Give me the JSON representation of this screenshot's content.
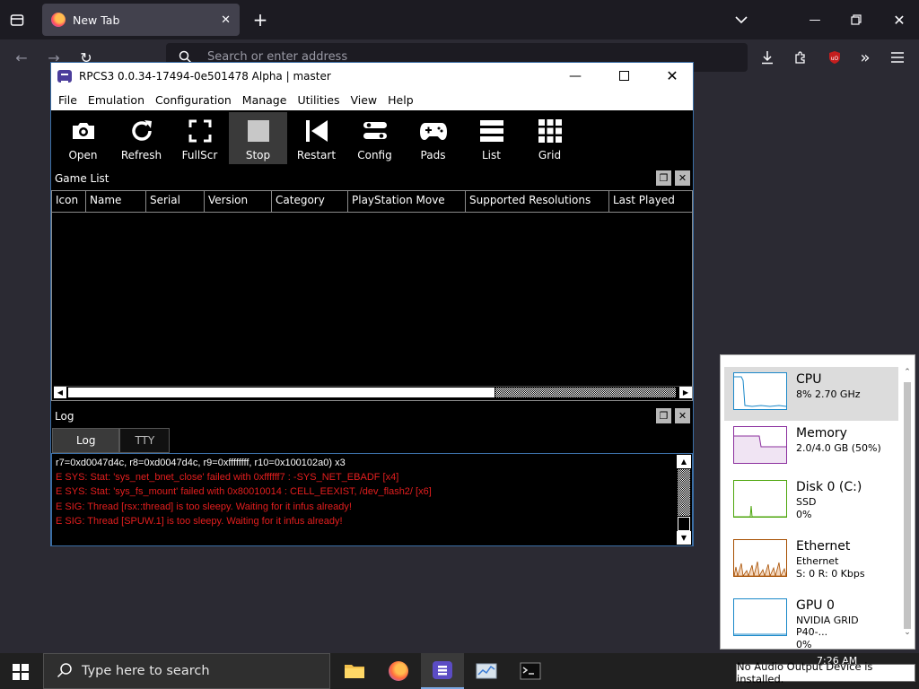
{
  "firefox": {
    "tab_title": "New Tab",
    "url_placeholder": "Search or enter address"
  },
  "rpcs3": {
    "title": "RPCS3 0.0.34-17494-0e501478 Alpha | master",
    "menu": [
      "File",
      "Emulation",
      "Configuration",
      "Manage",
      "Utilities",
      "View",
      "Help"
    ],
    "toolbar": {
      "open": "Open",
      "refresh": "Refresh",
      "fullscr": "FullScr",
      "stop": "Stop",
      "restart": "Restart",
      "config": "Config",
      "pads": "Pads",
      "list": "List",
      "grid": "Grid"
    },
    "game_list": {
      "title": "Game List",
      "columns": [
        "Icon",
        "Name",
        "Serial",
        "Version",
        "Category",
        "PlayStation Move",
        "Supported Resolutions",
        "Last Played"
      ]
    },
    "log": {
      "title": "Log",
      "tabs": [
        "Log",
        "TTY"
      ],
      "lines": [
        "r7=0xd0047d4c, r8=0xd0047d4c, r9=0xffffffff, r10=0x100102a0) x3",
        "E SYS: Stat: 'sys_net_bnet_close' failed with 0xffffff7 : -SYS_NET_EBADF [x4]",
        "E SYS: Stat: 'sys_fs_mount' failed with 0x80010014 : CELL_EEXIST, /dev_flash2/ [x6]",
        "E SIG: Thread [rsx::thread] is too sleepy. Waiting for it infus already!",
        "E SIG: Thread [SPUW.1] is too sleepy. Waiting for it infus already!"
      ]
    }
  },
  "task_manager": {
    "items": [
      {
        "name": "CPU",
        "line2": "8%  2.70 GHz",
        "line3": "",
        "color": "#1a88c9"
      },
      {
        "name": "Memory",
        "line2": "2.0/4.0 GB (50%)",
        "line3": "",
        "color": "#8b2f9e"
      },
      {
        "name": "Disk 0 (C:)",
        "line2": "SSD",
        "line3": "0%",
        "color": "#4da60c"
      },
      {
        "name": "Ethernet",
        "line2": "Ethernet",
        "line3": "S: 0  R: 0 Kbps",
        "color": "#a74f01"
      },
      {
        "name": "GPU 0",
        "line2": "NVIDIA GRID P40-...",
        "line3": "0%",
        "color": "#1a88c9"
      }
    ]
  },
  "taskbar": {
    "search_placeholder": "Type here to search",
    "clock_time": "7:26 AM",
    "tooltip": "No Audio Output Device is installed."
  }
}
